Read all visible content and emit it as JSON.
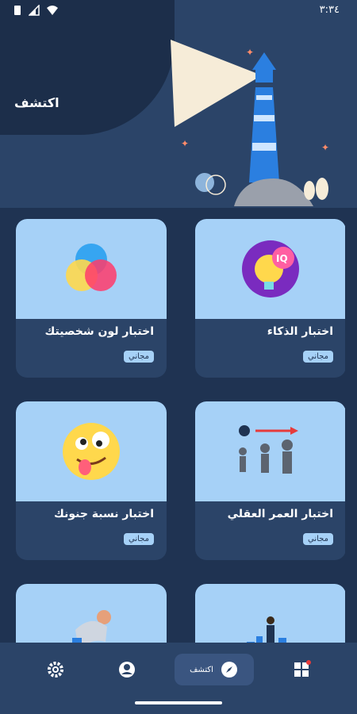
{
  "status": {
    "time": "٣:٣٤"
  },
  "header": {
    "title": "اكتشف"
  },
  "cards": [
    {
      "name": "اختبار الذكاء",
      "badge": "مجاني"
    },
    {
      "name": "اختبار لون شخصيتك",
      "badge": "مجاني"
    },
    {
      "name": "اختبار العمر العقلي",
      "badge": "مجاني"
    },
    {
      "name": "اختبار نسبة جنونك",
      "badge": "مجاني"
    },
    {
      "name": "",
      "badge": ""
    },
    {
      "name": "",
      "badge": ""
    }
  ],
  "nav": {
    "discover_label": "اكتشف",
    "icons": [
      "settings-icon",
      "profile-icon",
      "compass-icon",
      "dashboard-icon"
    ]
  },
  "colors": {
    "background": "#1f3352",
    "card": "#2b4468",
    "card_thumb": "#a6d1f7",
    "header": "#2b4468"
  }
}
